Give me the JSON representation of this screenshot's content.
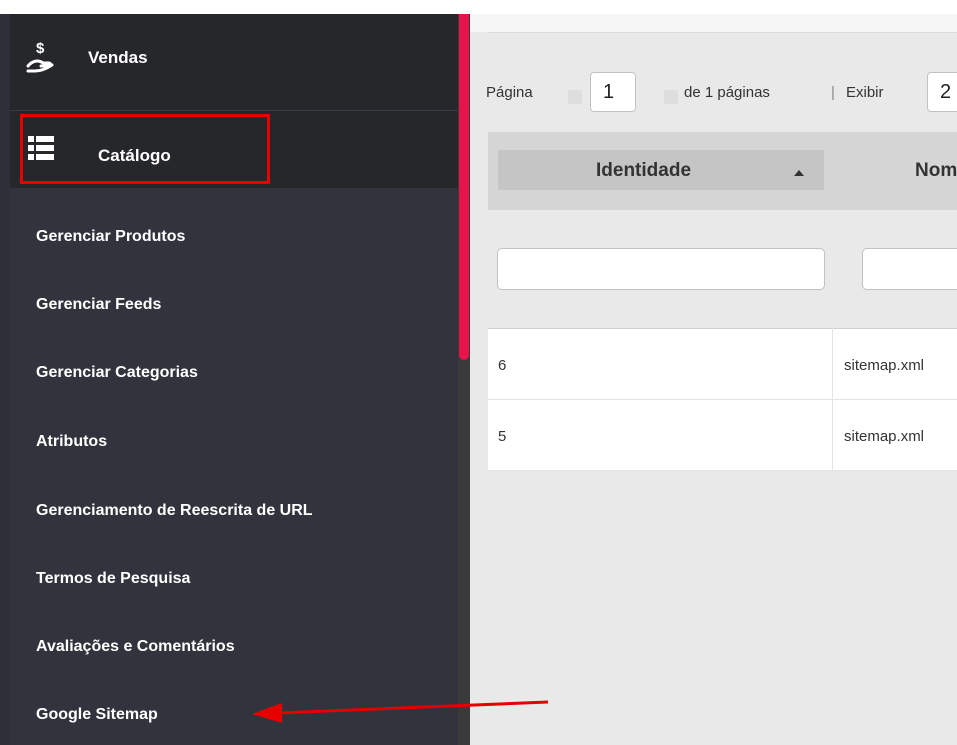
{
  "sidebar": {
    "primary": [
      {
        "label": "Vendas",
        "icon": "hand-dollar-icon"
      },
      {
        "label": "Catálogo",
        "icon": "list-icon"
      }
    ],
    "submenu": [
      "Gerenciar Produtos",
      "Gerenciar Feeds",
      "Gerenciar Categorias",
      "Atributos",
      "Gerenciamento de Reescrita de URL",
      "Termos de Pesquisa",
      "Avaliações e Comentários",
      "Google Sitemap"
    ]
  },
  "pager": {
    "page_label": "Página",
    "page_value": "1",
    "of_pages": "de 1 páginas",
    "separator": "|",
    "show_label": "Exibir",
    "show_value": "2"
  },
  "table": {
    "headers": [
      "Identidade",
      "Nom"
    ],
    "rows": [
      {
        "id": "6",
        "name": "sitemap.xml"
      },
      {
        "id": "5",
        "name": "sitemap.xml"
      }
    ]
  },
  "colors": {
    "highlight": "#e60000",
    "scroll_accent": "#e8134a",
    "sidebar_bg": "#2d3038"
  }
}
